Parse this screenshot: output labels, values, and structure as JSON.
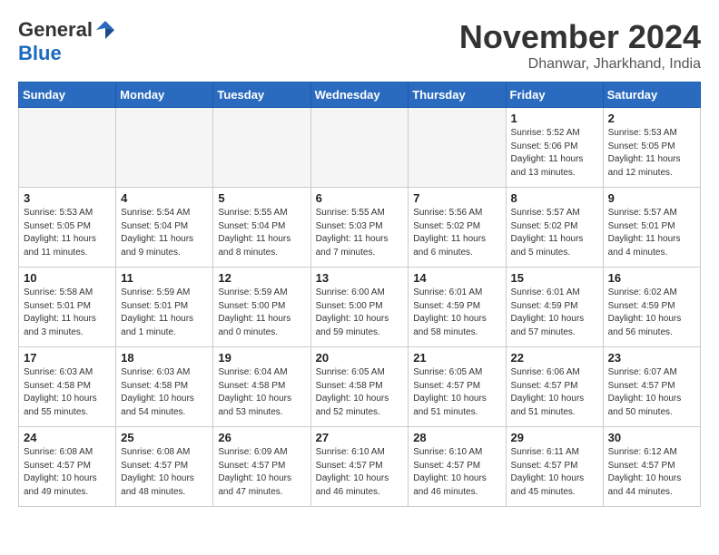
{
  "header": {
    "logo_general": "General",
    "logo_blue": "Blue",
    "month_title": "November 2024",
    "location": "Dhanwar, Jharkhand, India"
  },
  "weekdays": [
    "Sunday",
    "Monday",
    "Tuesday",
    "Wednesday",
    "Thursday",
    "Friday",
    "Saturday"
  ],
  "weeks": [
    [
      {
        "day": "",
        "info": ""
      },
      {
        "day": "",
        "info": ""
      },
      {
        "day": "",
        "info": ""
      },
      {
        "day": "",
        "info": ""
      },
      {
        "day": "",
        "info": ""
      },
      {
        "day": "1",
        "info": "Sunrise: 5:52 AM\nSunset: 5:06 PM\nDaylight: 11 hours\nand 13 minutes."
      },
      {
        "day": "2",
        "info": "Sunrise: 5:53 AM\nSunset: 5:05 PM\nDaylight: 11 hours\nand 12 minutes."
      }
    ],
    [
      {
        "day": "3",
        "info": "Sunrise: 5:53 AM\nSunset: 5:05 PM\nDaylight: 11 hours\nand 11 minutes."
      },
      {
        "day": "4",
        "info": "Sunrise: 5:54 AM\nSunset: 5:04 PM\nDaylight: 11 hours\nand 9 minutes."
      },
      {
        "day": "5",
        "info": "Sunrise: 5:55 AM\nSunset: 5:04 PM\nDaylight: 11 hours\nand 8 minutes."
      },
      {
        "day": "6",
        "info": "Sunrise: 5:55 AM\nSunset: 5:03 PM\nDaylight: 11 hours\nand 7 minutes."
      },
      {
        "day": "7",
        "info": "Sunrise: 5:56 AM\nSunset: 5:02 PM\nDaylight: 11 hours\nand 6 minutes."
      },
      {
        "day": "8",
        "info": "Sunrise: 5:57 AM\nSunset: 5:02 PM\nDaylight: 11 hours\nand 5 minutes."
      },
      {
        "day": "9",
        "info": "Sunrise: 5:57 AM\nSunset: 5:01 PM\nDaylight: 11 hours\nand 4 minutes."
      }
    ],
    [
      {
        "day": "10",
        "info": "Sunrise: 5:58 AM\nSunset: 5:01 PM\nDaylight: 11 hours\nand 3 minutes."
      },
      {
        "day": "11",
        "info": "Sunrise: 5:59 AM\nSunset: 5:01 PM\nDaylight: 11 hours\nand 1 minute."
      },
      {
        "day": "12",
        "info": "Sunrise: 5:59 AM\nSunset: 5:00 PM\nDaylight: 11 hours\nand 0 minutes."
      },
      {
        "day": "13",
        "info": "Sunrise: 6:00 AM\nSunset: 5:00 PM\nDaylight: 10 hours\nand 59 minutes."
      },
      {
        "day": "14",
        "info": "Sunrise: 6:01 AM\nSunset: 4:59 PM\nDaylight: 10 hours\nand 58 minutes."
      },
      {
        "day": "15",
        "info": "Sunrise: 6:01 AM\nSunset: 4:59 PM\nDaylight: 10 hours\nand 57 minutes."
      },
      {
        "day": "16",
        "info": "Sunrise: 6:02 AM\nSunset: 4:59 PM\nDaylight: 10 hours\nand 56 minutes."
      }
    ],
    [
      {
        "day": "17",
        "info": "Sunrise: 6:03 AM\nSunset: 4:58 PM\nDaylight: 10 hours\nand 55 minutes."
      },
      {
        "day": "18",
        "info": "Sunrise: 6:03 AM\nSunset: 4:58 PM\nDaylight: 10 hours\nand 54 minutes."
      },
      {
        "day": "19",
        "info": "Sunrise: 6:04 AM\nSunset: 4:58 PM\nDaylight: 10 hours\nand 53 minutes."
      },
      {
        "day": "20",
        "info": "Sunrise: 6:05 AM\nSunset: 4:58 PM\nDaylight: 10 hours\nand 52 minutes."
      },
      {
        "day": "21",
        "info": "Sunrise: 6:05 AM\nSunset: 4:57 PM\nDaylight: 10 hours\nand 51 minutes."
      },
      {
        "day": "22",
        "info": "Sunrise: 6:06 AM\nSunset: 4:57 PM\nDaylight: 10 hours\nand 51 minutes."
      },
      {
        "day": "23",
        "info": "Sunrise: 6:07 AM\nSunset: 4:57 PM\nDaylight: 10 hours\nand 50 minutes."
      }
    ],
    [
      {
        "day": "24",
        "info": "Sunrise: 6:08 AM\nSunset: 4:57 PM\nDaylight: 10 hours\nand 49 minutes."
      },
      {
        "day": "25",
        "info": "Sunrise: 6:08 AM\nSunset: 4:57 PM\nDaylight: 10 hours\nand 48 minutes."
      },
      {
        "day": "26",
        "info": "Sunrise: 6:09 AM\nSunset: 4:57 PM\nDaylight: 10 hours\nand 47 minutes."
      },
      {
        "day": "27",
        "info": "Sunrise: 6:10 AM\nSunset: 4:57 PM\nDaylight: 10 hours\nand 46 minutes."
      },
      {
        "day": "28",
        "info": "Sunrise: 6:10 AM\nSunset: 4:57 PM\nDaylight: 10 hours\nand 46 minutes."
      },
      {
        "day": "29",
        "info": "Sunrise: 6:11 AM\nSunset: 4:57 PM\nDaylight: 10 hours\nand 45 minutes."
      },
      {
        "day": "30",
        "info": "Sunrise: 6:12 AM\nSunset: 4:57 PM\nDaylight: 10 hours\nand 44 minutes."
      }
    ]
  ]
}
